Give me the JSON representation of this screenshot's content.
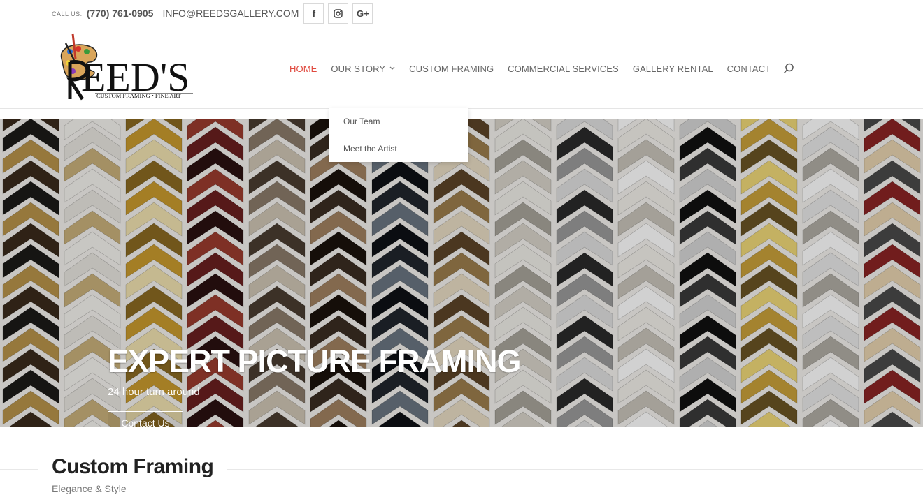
{
  "topbar": {
    "call_label": "CALL US:",
    "phone": "(770) 761-0905",
    "email": "INFO@REEDSGALLERY.COM",
    "social": [
      {
        "name": "facebook-icon",
        "glyph": "f"
      },
      {
        "name": "instagram-icon",
        "glyph": ""
      },
      {
        "name": "google-plus-icon",
        "glyph": "G+"
      }
    ]
  },
  "logo": {
    "wordmark": "REED'S",
    "tagline": "CUSTOM FRAMING • FINE ART"
  },
  "nav": {
    "items": [
      {
        "label": "HOME",
        "active": true
      },
      {
        "label": "OUR STORY",
        "has_dropdown": true
      },
      {
        "label": "CUSTOM FRAMING"
      },
      {
        "label": "COMMERCIAL SERVICES"
      },
      {
        "label": "GALLERY RENTAL"
      },
      {
        "label": "CONTACT"
      }
    ],
    "search_icon": "search-icon"
  },
  "dropdown": {
    "items": [
      "Our Team",
      "Meet the Artist"
    ]
  },
  "hero": {
    "title": "EXPERT PICTURE FRAMING",
    "subtitle": "24 hour turn around",
    "button": "Contact Us"
  },
  "section": {
    "title": "Custom Framing",
    "subtitle": "Elegance & Style"
  },
  "colors": {
    "accent": "#e0493e",
    "nav_text": "#666666",
    "white": "#ffffff"
  }
}
